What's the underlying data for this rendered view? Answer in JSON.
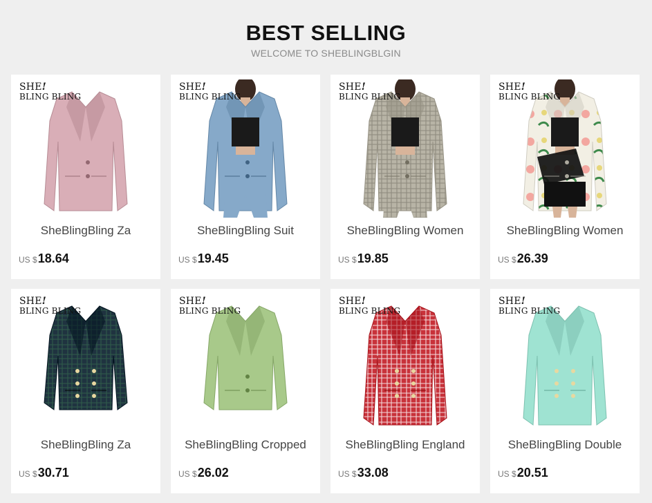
{
  "header": {
    "title": "BEST SELLING",
    "subtitle": "WELCOME TO SHEBLINGBLGIN"
  },
  "brand_logo": {
    "line1": "SHE",
    "bang": "!",
    "line2": "BLING BLING"
  },
  "products": [
    {
      "name": "SheBlingBling Za",
      "currency": "US $",
      "price": "18.64",
      "color": "#d9aeb7",
      "style": "blazer-pink"
    },
    {
      "name": "SheBlingBling Suit",
      "currency": "US $",
      "price": "19.45",
      "color": "#86a9c9",
      "style": "suit-blue"
    },
    {
      "name": "SheBlingBling Women",
      "currency": "US $",
      "price": "19.85",
      "color": "#b8b4a6",
      "style": "plaid-grey"
    },
    {
      "name": "SheBlingBling Women",
      "currency": "US $",
      "price": "26.39",
      "color": "#f2efe4",
      "style": "floral-white"
    },
    {
      "name": "SheBlingBling Za",
      "currency": "US $",
      "price": "30.71",
      "color": "#1f3340",
      "style": "tartan-navy"
    },
    {
      "name": "SheBlingBling Cropped",
      "currency": "US $",
      "price": "26.02",
      "color": "#a8c98a",
      "style": "cropped-green"
    },
    {
      "name": "SheBlingBling England",
      "currency": "US $",
      "price": "33.08",
      "color": "#c8323a",
      "style": "plaid-red"
    },
    {
      "name": "SheBlingBling Double",
      "currency": "US $",
      "price": "20.51",
      "color": "#9fe3d2",
      "style": "mint-double"
    }
  ]
}
